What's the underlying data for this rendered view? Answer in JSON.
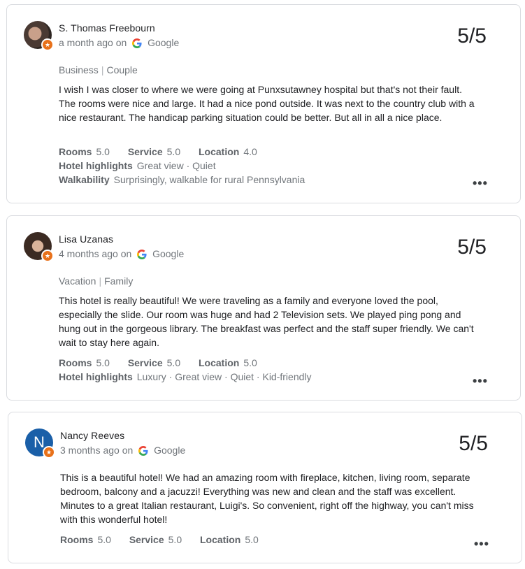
{
  "reviews": [
    {
      "author": "S. Thomas Freebourn",
      "time": "a month ago",
      "on": "on",
      "source": "Google",
      "score": "5/5",
      "trip_type": "Business",
      "companions": "Couple",
      "text": "I wish I was closer to where we were going at Punxsutawney hospital but that's not their fault. The rooms were nice and large. It had a nice pond outside. It was next to the country club with a nice restaurant. The handicap parking situation could be better. But all in all a nice place.",
      "ratings": [
        {
          "label": "Rooms",
          "value": "5.0"
        },
        {
          "label": "Service",
          "value": "5.0"
        },
        {
          "label": "Location",
          "value": "4.0"
        }
      ],
      "highlights_label": "Hotel highlights",
      "highlights": "Great view · Quiet",
      "walkability_label": "Walkability",
      "walkability": "Surprisingly, walkable for rural Pennsylvania"
    },
    {
      "author": "Lisa Uzanas",
      "time": "4 months ago",
      "on": "on",
      "source": "Google",
      "score": "5/5",
      "trip_type": "Vacation",
      "companions": "Family",
      "text": "This hotel is really beautiful! We were traveling as a family and everyone loved the pool, especially the slide. Our room was huge and had 2 Television sets. We played ping pong and hung out in the gorgeous library. The breakfast was perfect and the staff super friendly. We can't wait to stay here again.",
      "ratings": [
        {
          "label": "Rooms",
          "value": "5.0"
        },
        {
          "label": "Service",
          "value": "5.0"
        },
        {
          "label": "Location",
          "value": "5.0"
        }
      ],
      "highlights_label": "Hotel highlights",
      "highlights": "Luxury · Great view · Quiet · Kid-friendly"
    },
    {
      "author": "Nancy Reeves",
      "avatar_letter": "N",
      "time": "3 months ago",
      "on": "on",
      "source": "Google",
      "score": "5/5",
      "text": "This is a beautiful hotel! We had an amazing room with fireplace, kitchen, living room, separate bedroom, balcony and a jacuzzi! Everything was new and clean and the staff was excellent. Minutes to a great Italian restaurant, Luigi's. So convenient, right off the highway, you can't miss with this wonderful hotel!",
      "ratings": [
        {
          "label": "Rooms",
          "value": "5.0"
        },
        {
          "label": "Service",
          "value": "5.0"
        },
        {
          "label": "Location",
          "value": "5.0"
        }
      ]
    }
  ],
  "icons": {
    "more": "more-horizontal-icon",
    "source": "google-g-icon",
    "badge": "local-guide-badge-icon"
  },
  "colors": {
    "text": "#202124",
    "muted": "#70757a",
    "label": "#5f6368",
    "border": "#dadce0",
    "badge": "#e8711a",
    "avatar_blue": "#1a5fa8"
  }
}
